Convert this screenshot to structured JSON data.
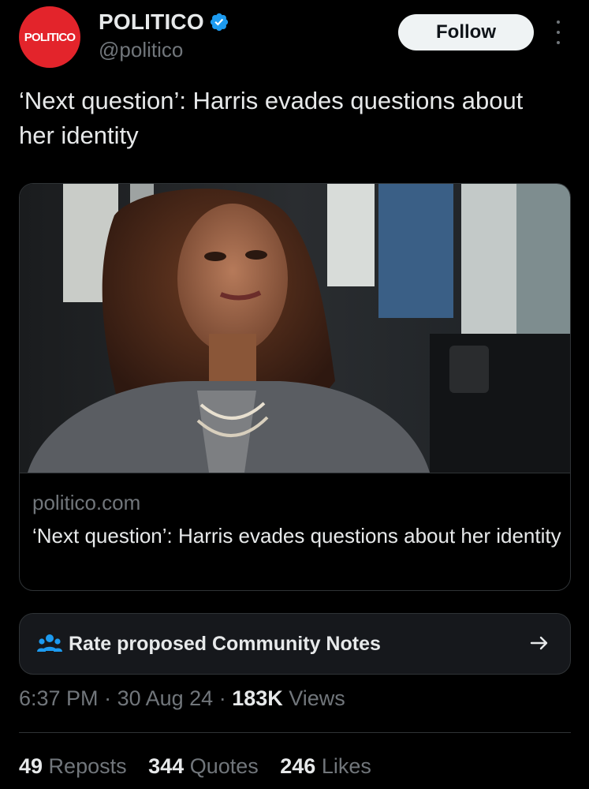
{
  "author": {
    "avatar_text": "POLITICO",
    "display_name": "POLITICO",
    "handle": "@politico",
    "verified_icon": "verified-badge-icon",
    "brand_color": "#e3242b",
    "verified_color": "#1d9bf0"
  },
  "actions": {
    "follow_label": "Follow",
    "more_icon": "more-vertical-icon"
  },
  "tweet": {
    "text": "‘Next question’: Harris evades questions about her identity"
  },
  "card": {
    "domain": "politico.com",
    "title": "‘Next question’: Harris evades questions about her identity"
  },
  "community_notes": {
    "label": "Rate proposed Community Notes",
    "icon": "people-icon",
    "arrow_icon": "arrow-right-icon"
  },
  "meta": {
    "time": "6:37 PM",
    "sep1": " · ",
    "date": "30 Aug 24",
    "sep2": " · ",
    "views_count": "183K",
    "views_label": " Views"
  },
  "stats": {
    "reposts_count": "49",
    "reposts_label": " Reposts",
    "quotes_count": "344",
    "quotes_label": " Quotes",
    "likes_count": "246",
    "likes_label": " Likes"
  }
}
